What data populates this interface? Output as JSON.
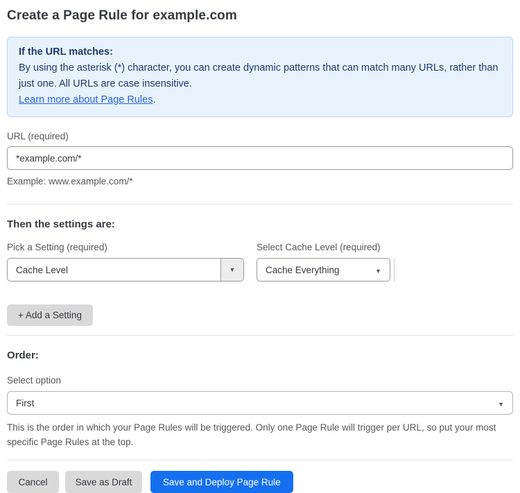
{
  "page": {
    "title": "Create a Page Rule for example.com"
  },
  "info_box": {
    "heading": "If the URL matches:",
    "body": "By using the asterisk (*) character, you can create dynamic patterns that can match many URLs, rather than just one. All URLs are case insensitive.",
    "link_label": "Learn more about Page Rules",
    "link_suffix": "."
  },
  "url_field": {
    "label": "URL (required)",
    "value": "*example.com/*",
    "example": "Example: www.example.com/*"
  },
  "settings": {
    "heading": "Then the settings are:",
    "setting_select": {
      "label": "Pick a Setting (required)",
      "value": "Cache Level"
    },
    "cache_level_select": {
      "label": "Select Cache Level (required)",
      "value": "Cache Everything"
    },
    "add_button_label": "+ Add a Setting"
  },
  "order": {
    "heading": "Order:",
    "select_label": "Select option",
    "value": "First",
    "help": "This is the order in which your Page Rules will be triggered. Only one Page Rule will trigger per URL, so put your most specific Page Rules at the top."
  },
  "actions": {
    "cancel": "Cancel",
    "save_draft": "Save as Draft",
    "save_deploy": "Save and Deploy Page Rule"
  },
  "icons": {
    "dropdown_arrow": "chevron-down-icon"
  },
  "glyphs": {
    "dropdown_arrow": "▼"
  },
  "colors": {
    "accent_blue": "#1570f0",
    "info_bg": "#e8f2fd",
    "info_border": "#b3d4f1",
    "info_text": "#1e3a6d",
    "link_blue": "#2563d8",
    "heading_text": "#36393f",
    "label_text": "#56565c",
    "control_border": "#999999",
    "btn_gray": "#d9d9d9",
    "divider": "#e3e3e3"
  }
}
